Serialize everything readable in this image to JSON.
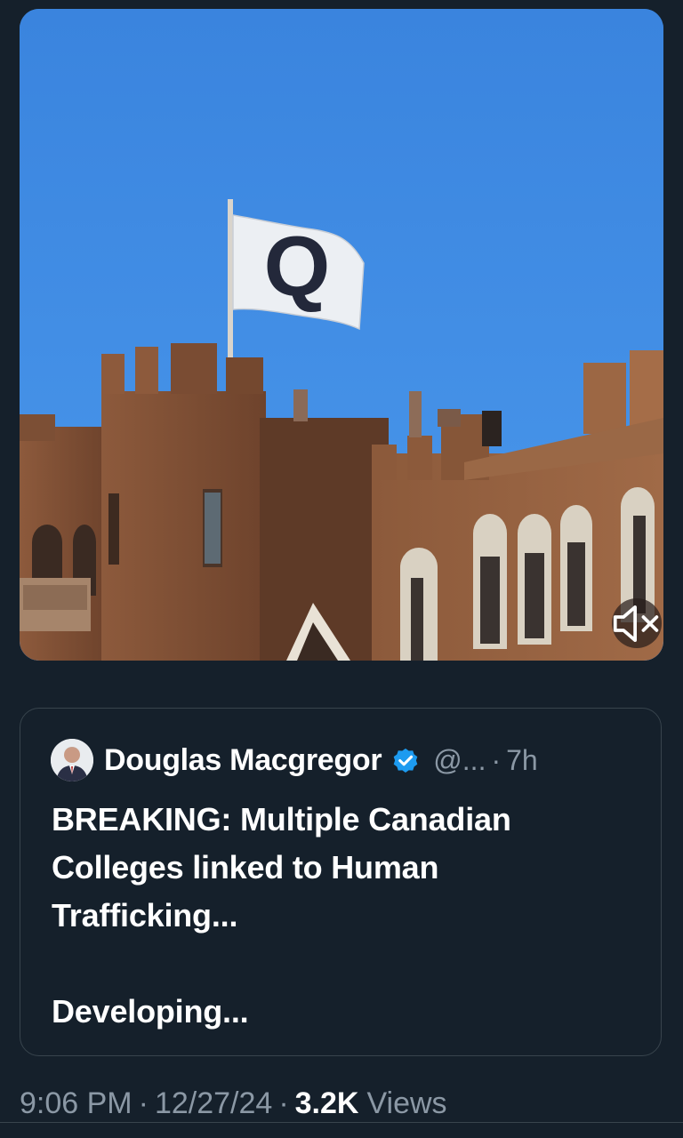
{
  "media": {
    "flag_letter": "Q",
    "mute_icon": "speaker-muted-icon"
  },
  "quote": {
    "author_name": "Douglas Macgregor",
    "verified_icon": "verified-badge-icon",
    "handle": "@...",
    "separator": "·",
    "time_ago": "7h",
    "text_line_1": "BREAKING: Multiple Canadian Colleges linked to Human Trafficking...",
    "text_line_2": "Developing..."
  },
  "meta": {
    "time": "9:06 PM",
    "separator": "·",
    "date": "12/27/24",
    "views_count": "3.2K",
    "views_label": "Views"
  },
  "colors": {
    "background": "#15202b",
    "border": "#38444d",
    "secondary_text": "#8b98a5",
    "verified_blue": "#1d9bf0",
    "sky": "#3f8be0"
  }
}
